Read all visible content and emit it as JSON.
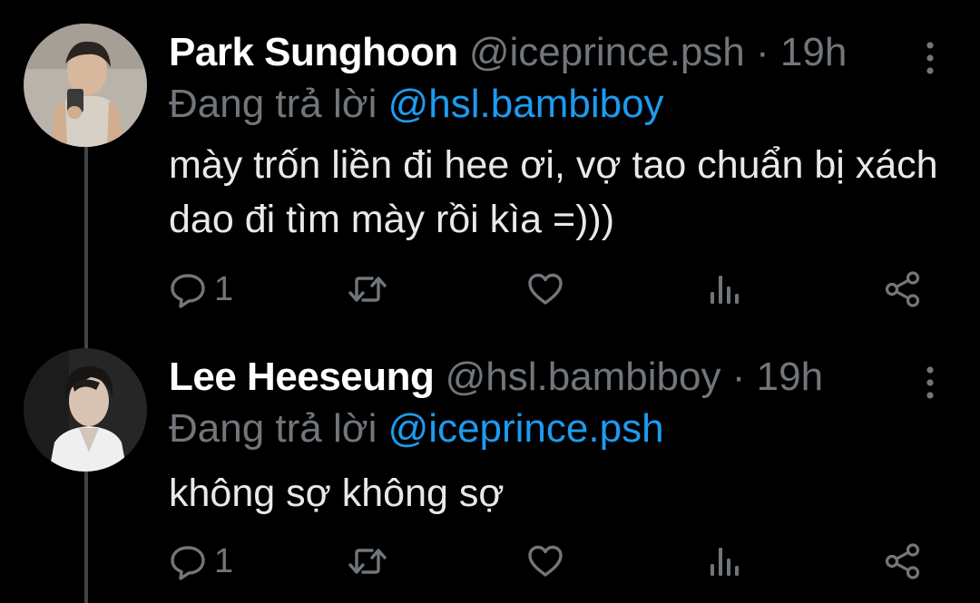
{
  "colors": {
    "background": "#000000",
    "name": "#ffffff",
    "muted": "#71767b",
    "link": "#1d9bf0",
    "text": "#e7e9ea",
    "thread_line": "#3f4448"
  },
  "tweets": [
    {
      "name": "Park Sunghoon",
      "handle": "@iceprince.psh",
      "separator": "·",
      "time": "19h",
      "reply_prefix": "Đang trả lời",
      "reply_to": "@hsl.bambiboy",
      "text": "mày trốn liền đi hee ơi, vợ tao chuẩn bị xách dao đi tìm mày rồi kìa =)))",
      "reply_count": "1",
      "icons": [
        "reply-icon",
        "retweet-icon",
        "like-icon",
        "analytics-icon",
        "share-icon",
        "more-icon"
      ]
    },
    {
      "name": "Lee Heeseung",
      "handle": "@hsl.bambiboy",
      "separator": "·",
      "time": "19h",
      "reply_prefix": "Đang trả lời",
      "reply_to": "@iceprince.psh",
      "text": "không sợ không sợ",
      "reply_count": "1",
      "icons": [
        "reply-icon",
        "retweet-icon",
        "like-icon",
        "analytics-icon",
        "share-icon",
        "more-icon"
      ]
    }
  ]
}
